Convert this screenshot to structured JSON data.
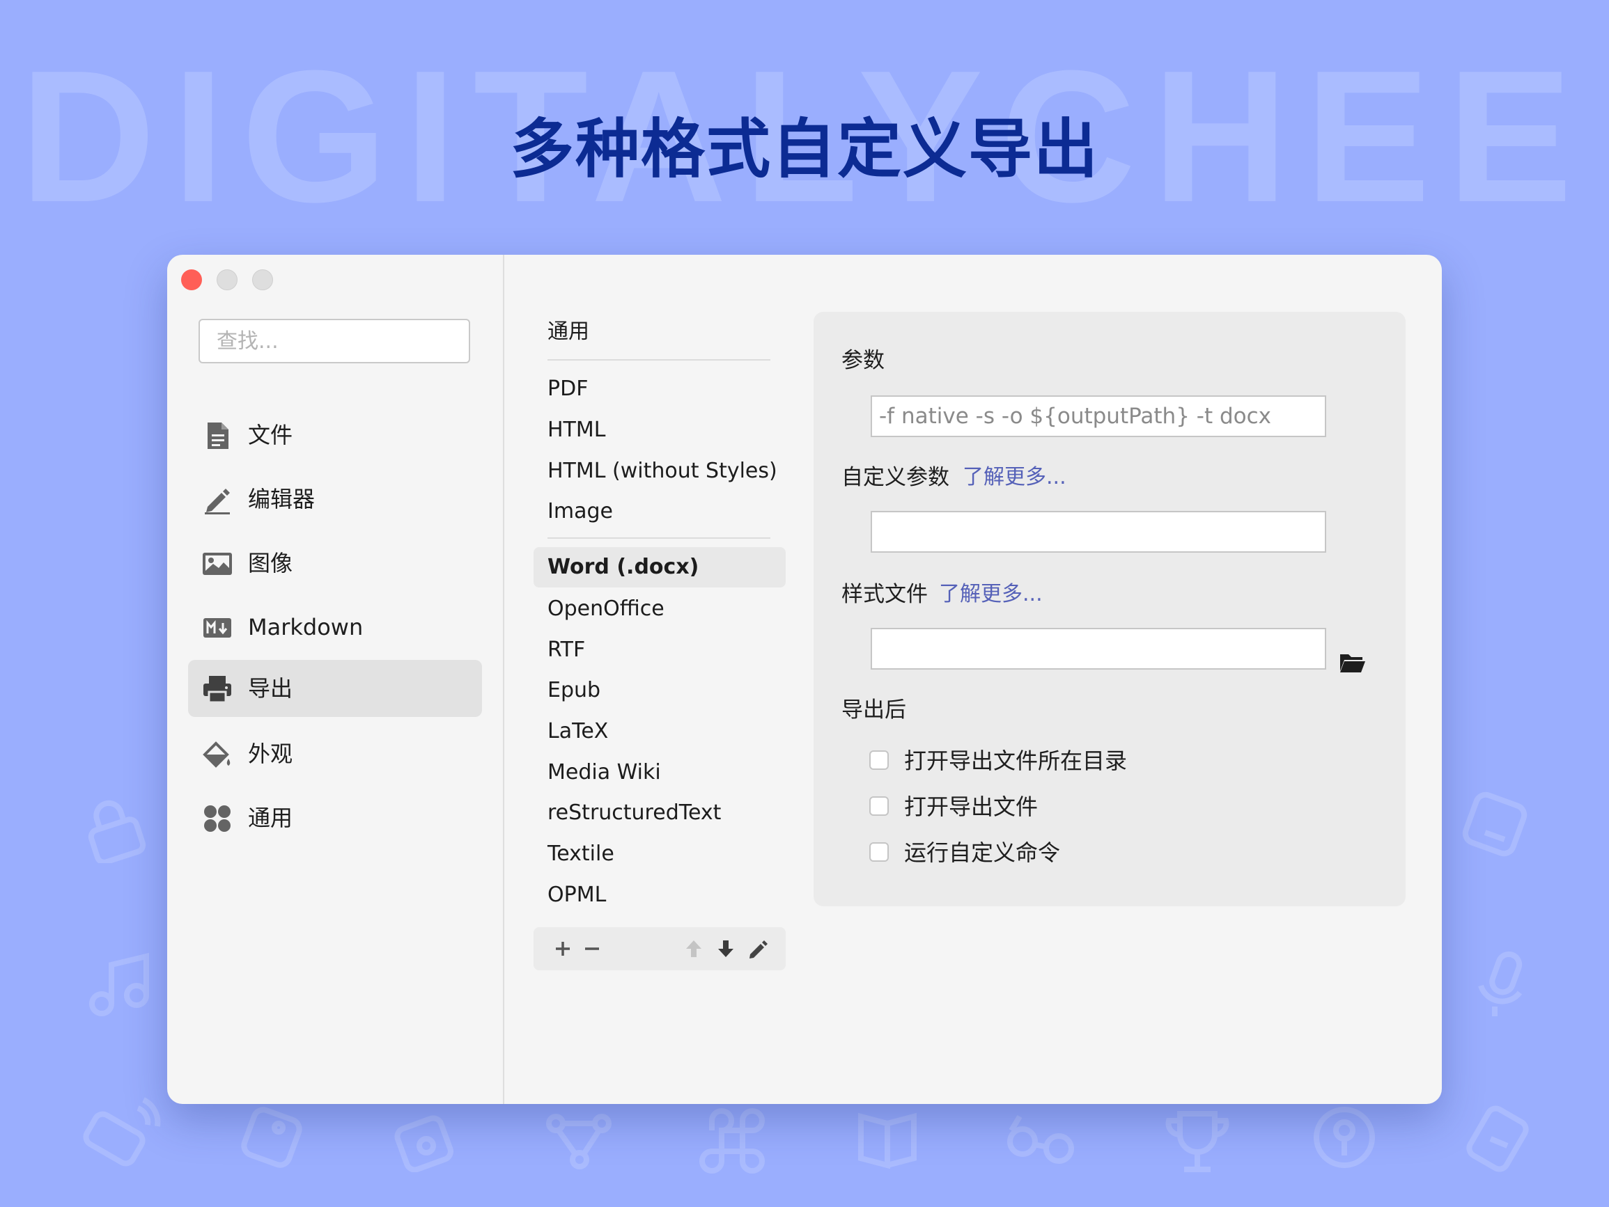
{
  "watermark": "DIGITALYCHEE",
  "headline": "多种格式自定义导出",
  "search": {
    "placeholder": "查找..."
  },
  "sidebar": {
    "items": [
      {
        "label": "文件",
        "icon": "document-icon"
      },
      {
        "label": "编辑器",
        "icon": "pencil-icon"
      },
      {
        "label": "图像",
        "icon": "image-icon"
      },
      {
        "label": "Markdown",
        "icon": "markdown-icon"
      },
      {
        "label": "导出",
        "icon": "printer-icon",
        "active": true
      },
      {
        "label": "外观",
        "icon": "paint-bucket-icon"
      },
      {
        "label": "通用",
        "icon": "grid-icon"
      }
    ]
  },
  "formats": {
    "header": "通用",
    "group1": [
      "PDF",
      "HTML",
      "HTML (without Styles)",
      "Image"
    ],
    "selected": "Word (.docx)",
    "group2": [
      "OpenOffice",
      "RTF",
      "Epub",
      "LaTeX",
      "Media Wiki",
      "reStructuredText",
      "Textile",
      "OPML"
    ]
  },
  "panel": {
    "params_label": "参数",
    "params_placeholder": "-f native -s -o ${outputPath} -t docx",
    "custom_params_label": "自定义参数",
    "custom_params_link": "了解更多...",
    "custom_params_value": "",
    "style_file_label": "样式文件",
    "style_file_link": "了解更多...",
    "style_file_value": "",
    "after_export_label": "导出后",
    "options": [
      {
        "label": "打开导出文件所在目录",
        "checked": false
      },
      {
        "label": "打开导出文件",
        "checked": false
      },
      {
        "label": "运行自定义命令",
        "checked": false
      }
    ]
  }
}
